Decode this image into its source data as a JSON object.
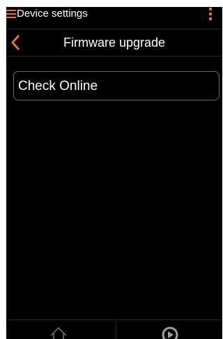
{
  "topbar": {
    "title": "Device settings",
    "menu_icon": "hamburger-menu-icon",
    "more_icon": "kebab-menu-icon"
  },
  "header": {
    "title": "Firmware upgrade",
    "back_icon": "chevron-left-icon"
  },
  "main": {
    "check_online_label": "Check Online"
  },
  "bottom_nav": {
    "left_icon": "home-icon",
    "right_icon": "play-circle-icon"
  },
  "colors": {
    "accent": "#e8702a",
    "background": "#000000",
    "text": "#ffffff",
    "button_border": "#6a6a6a"
  }
}
